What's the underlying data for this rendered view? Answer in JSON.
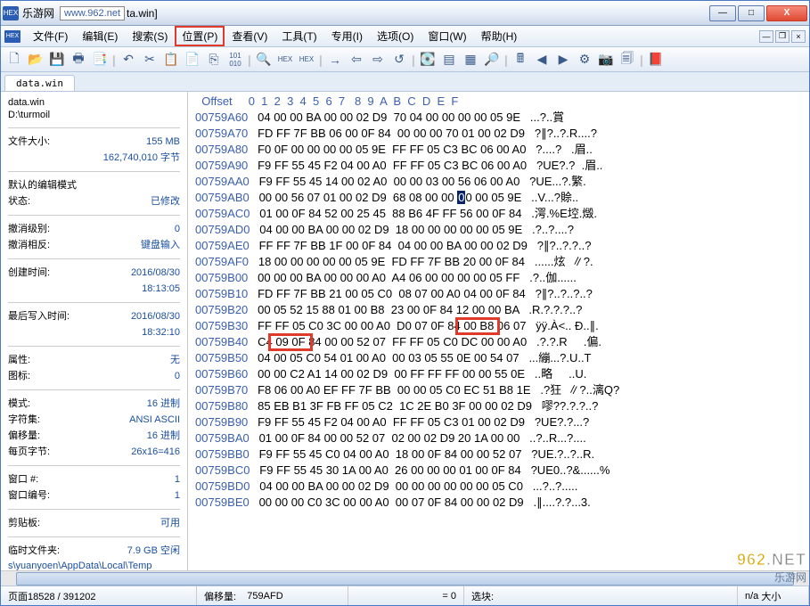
{
  "titlebar": {
    "watermark_site": "www.962.net",
    "watermark_label": "乐游网",
    "title_suffix": "ta.win]"
  },
  "winbtns": {
    "min": "—",
    "max": "□",
    "close": "X"
  },
  "menu": {
    "icon": "HEX",
    "items": [
      "文件(F)",
      "编辑(E)",
      "搜索(S)",
      "位置(P)",
      "查看(V)",
      "工具(T)",
      "专用(I)",
      "选项(O)",
      "窗口(W)",
      "帮助(H)"
    ],
    "highlight_index": 3
  },
  "tab": {
    "label": "data.win"
  },
  "sidepanel": {
    "filename": "data.win",
    "path": "D:\\turmoil",
    "filesize_label": "文件大小:",
    "filesize_val": "155 MB",
    "filesize_bytes": "162,740,010 字节",
    "defedit_label": "默认的编辑模式",
    "state_label": "状态:",
    "state_val": "已修改",
    "undolvl_label": "撤消级别:",
    "undolvl_val": "0",
    "undorev_label": "撤消相反:",
    "undorev_val": "键盘输入",
    "ctime_label": "创建时间:",
    "ctime_val": "2016/08/30",
    "ctime_val2": "18:13:05",
    "mtime_label": "最后写入时间:",
    "mtime_val": "2016/08/30",
    "mtime_val2": "18:32:10",
    "attr_label": "属性:",
    "attr_val": "无",
    "icon_label": "图标:",
    "icon_val": "0",
    "mode_label": "模式:",
    "mode_val": "16 进制",
    "charset_label": "字符集:",
    "charset_val": "ANSI ASCII",
    "offmode_label": "偏移量:",
    "offmode_val": "16 进制",
    "bpr_label": "每页字节:",
    "bpr_val": "26x16=416",
    "wnd_label": "窗口 #:",
    "wnd_val": "1",
    "wndno_label": "窗口编号:",
    "wndno_val": "1",
    "clip_label": "剪贴板:",
    "clip_val": "可用",
    "tmp_label": "临时文件夹:",
    "tmp_val": "7.9 GB 空闲",
    "tmp_path": "s\\yuanyoen\\AppData\\Local\\Temp"
  },
  "hex": {
    "header_offset": "Offset",
    "header_cols": "0  1  2  3  4  5  6  7   8  9  A  B  C  D  E  F",
    "lines": [
      {
        "off": "00759A60",
        "b": "04 00 00 BA 00 00 02 D9  70 04 00 00 00 00 05 9E",
        "a": "...?..賞"
      },
      {
        "off": "00759A70",
        "b": "FD FF 7F BB 06 00 0F 84  00 00 00 70 01 00 02 D9",
        "a": "?∥?..?.R....?"
      },
      {
        "off": "00759A80",
        "b": "F0 0F 00 00 00 00 05 9E  FF FF 05 C3 BC 06 00 A0",
        "a": "?....?   .眉.."
      },
      {
        "off": "00759A90",
        "b": "F9 FF 55 45 F2 04 00 A0  FF FF 05 C3 BC 06 00 A0",
        "a": "?UE?.?  .眉.."
      },
      {
        "off": "00759AA0",
        "b": "F9 FF 55 45 14 00 02 A0  00 00 03 00 56 06 00 A0",
        "a": "?UE...?.繁."
      },
      {
        "off": "00759AB0",
        "b": "00 00 56 07 01 00 02 D9  68 08 00 00 00 00 05 9E",
        "a": "..V...?賒.."
      },
      {
        "off": "00759AC0",
        "b": "01 00 0F 84 52 00 25 45  88 B6 4F FF 56 00 0F 84",
        "a": ".湂.%E埪.燬."
      },
      {
        "off": "00759AD0",
        "b": "04 00 00 BA 00 00 02 D9  18 00 00 00 00 00 05 9E",
        "a": ".?..?....?"
      },
      {
        "off": "00759AE0",
        "b": "FF FF 7F BB 1F 00 0F 84  04 00 00 BA 00 00 02 D9",
        "a": "?∥?..?.?..?"
      },
      {
        "off": "00759AF0",
        "b": "18 00 00 00 00 00 05 9E  FD FF 7F BB 20 00 0F 84",
        "a": "......炫  ∥?."
      },
      {
        "off": "00759B00",
        "b": "00 00 00 BA 00 00 00 A0  A4 06 00 00 00 00 05 FF",
        "a": ".?..伽......"
      },
      {
        "off": "00759B10",
        "b": "FD FF 7F BB 21 00 05 C0  08 07 00 A0 04 00 0F 84",
        "a": "?∥?..?..?..?"
      },
      {
        "off": "00759B20",
        "b": "00 05 52 15 88 01 00 B8  23 00 0F 84 12 00 00 BA",
        "a": ".R.?.?.?..?"
      },
      {
        "off": "00759B30",
        "b": "FF FF 05 C0 3C 00 00 A0  D0 07 0F 84 00 B8 06 07",
        "a": "ÿÿ.À<.. Ð..∥."
      },
      {
        "off": "00759B40",
        "b": "C4 09 0F 84 00 00 52 07  FF FF 05 C0 DC 00 00 A0",
        "a": ".?.?.R     .偏."
      },
      {
        "off": "00759B50",
        "b": "04 00 05 C0 54 01 00 A0  00 03 05 55 0E 00 54 07",
        "a": "...繃...?.U..T"
      },
      {
        "off": "00759B60",
        "b": "00 00 C2 A1 14 00 02 D9  00 FF FF FF 00 00 55 0E",
        "a": "..略     ..U."
      },
      {
        "off": "00759B70",
        "b": "F8 06 00 A0 EF FF 7F BB  00 00 05 C0 EC 51 B8 1E",
        "a": ".?狂  ∥?..漓Q?"
      },
      {
        "off": "00759B80",
        "b": "85 EB B1 3F FB FF 05 C2  1C 2E B0 3F 00 00 02 D9",
        "a": "嘐??.?.?..?"
      },
      {
        "off": "00759B90",
        "b": "F9 FF 55 45 F2 04 00 A0  FF FF 05 C3 01 00 02 D9",
        "a": "?UE?.?...?"
      },
      {
        "off": "00759BA0",
        "b": "01 00 0F 84 00 00 52 07  02 00 02 D9 20 1A 00 00",
        "a": "..?..R...?...."
      },
      {
        "off": "00759BB0",
        "b": "F9 FF 55 45 C0 04 00 A0  18 00 0F 84 00 00 52 07",
        "a": "?UE.?..?..R."
      },
      {
        "off": "00759BC0",
        "b": "F9 FF 55 45 30 1A 00 A0  26 00 00 00 01 00 0F 84",
        "a": "?UE0..?&......%"
      },
      {
        "off": "00759BD0",
        "b": "04 00 00 BA 00 00 02 D9  00 00 00 00 00 00 05 C0",
        "a": "...?..?....."
      },
      {
        "off": "00759BE0",
        "b": "00 00 00 C0 3C 00 00 A0  00 07 0F 84 00 00 02 D9",
        "a": ".∥....?.?...3."
      }
    ],
    "caret_line_index": 5,
    "caret_col": 12
  },
  "status": {
    "page": "页面18528 / 391202",
    "offset_label": "偏移量:",
    "offset_val": "759AFD",
    "eq": "= 0",
    "sel_label": "选块:",
    "na": "n/a",
    "size_label": "大小"
  },
  "watermark_br": {
    "big1": "962",
    "big2": ".NET",
    "small": "乐游网"
  }
}
